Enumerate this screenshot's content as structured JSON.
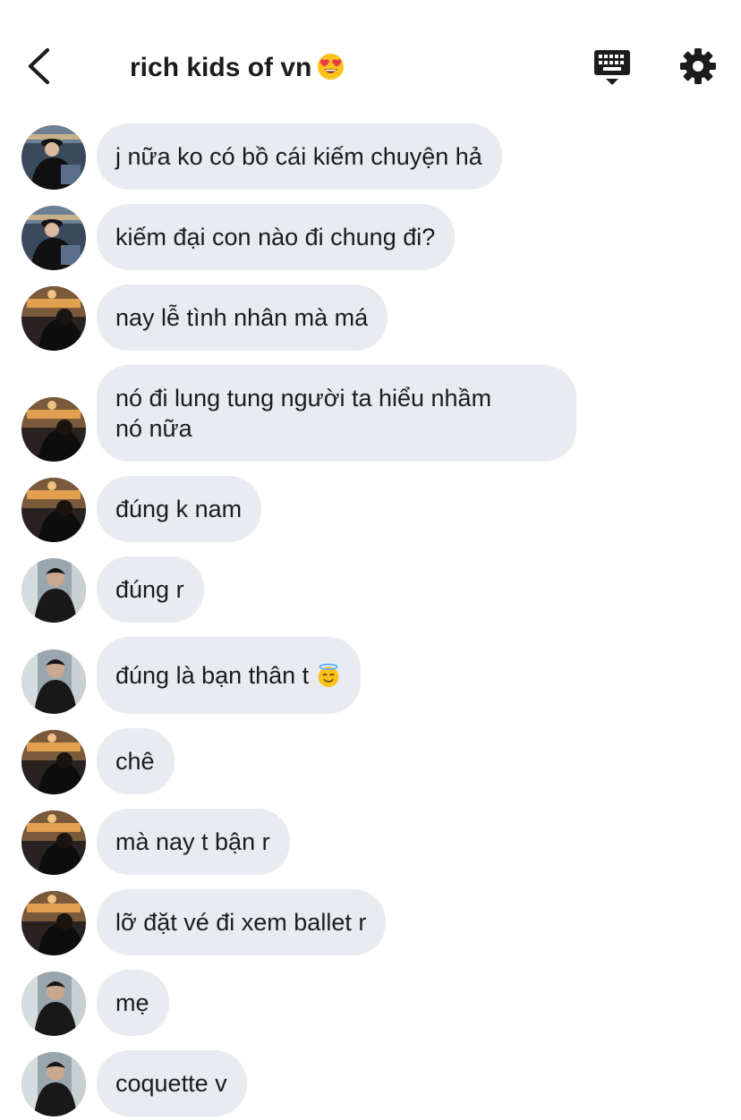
{
  "header": {
    "title": "rich kids of vn",
    "title_emoji": "heart-eyes-emoji",
    "icons": [
      "back-arrow-icon",
      "keyboard-icon",
      "gear-icon"
    ]
  },
  "colors": {
    "bubble": "#e8ecf0",
    "text": "#1c1c1e"
  },
  "messages": [
    {
      "text": "j nữa ko có bồ cái kiếm chuyện hả",
      "avatar": "user-a"
    },
    {
      "text": "kiếm đại con nào đi chung đi?",
      "avatar": "user-a"
    },
    {
      "text": "nay lễ tình nhân mà má",
      "avatar": "user-b"
    },
    {
      "text": "nó đi lung tung người ta hiểu nhầm\nnó nữa",
      "avatar": "user-b"
    },
    {
      "text": "đúng k nam",
      "avatar": "user-b"
    },
    {
      "text": "đúng r",
      "avatar": "user-c"
    },
    {
      "text": "đúng là bạn thân t",
      "avatar": "user-c",
      "emoji": "smiling-halo-emoji"
    },
    {
      "text": "chê",
      "avatar": "user-b"
    },
    {
      "text": "mà nay t bận r",
      "avatar": "user-b"
    },
    {
      "text": "lỡ đặt vé đi xem ballet r",
      "avatar": "user-b"
    },
    {
      "text": "mẹ",
      "avatar": "user-c"
    },
    {
      "text": "coquette v",
      "avatar": "user-c"
    }
  ]
}
